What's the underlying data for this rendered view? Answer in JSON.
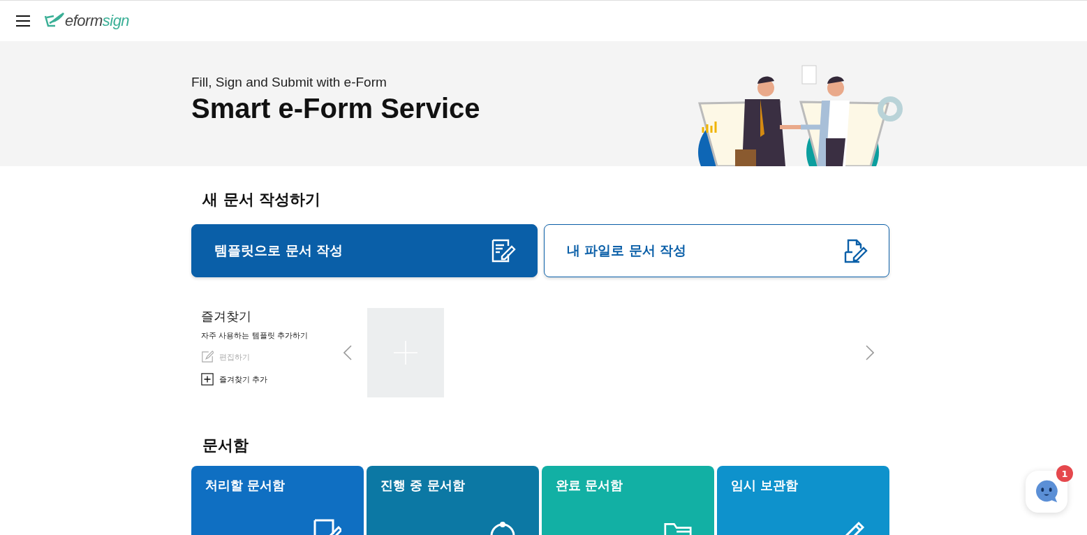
{
  "header": {
    "logo": {
      "text_main": "eform",
      "text_accent": "sign"
    }
  },
  "banner": {
    "subtitle": "Fill, Sign and Submit with e-Form",
    "title": "Smart e-Form Service"
  },
  "new_document": {
    "heading": "새 문서 작성하기",
    "actions": [
      {
        "label": "템플릿으로 문서 작성",
        "selected": true,
        "kind": "template"
      },
      {
        "label": "내 파일로 문서 작성",
        "selected": false,
        "kind": "file"
      }
    ]
  },
  "favorites": {
    "title": "즐겨찾기",
    "description": "자주 사용하는 템플릿 추가하기",
    "edit": {
      "label": "편집하기",
      "disabled": true
    },
    "add": {
      "label": "즐겨찾기 추가"
    }
  },
  "document_boxes": {
    "heading": "문서함",
    "boxes": [
      {
        "label": "처리할 문서함",
        "color": "#0f6fc2",
        "kind": "todo"
      },
      {
        "label": "진행 중 문서함",
        "color": "#0c78a4",
        "kind": "progress"
      },
      {
        "label": "완료 문서함",
        "color": "#12b0a4",
        "kind": "done"
      },
      {
        "label": "임시 보관함",
        "color": "#0e92cc",
        "kind": "draft"
      }
    ]
  },
  "chat": {
    "badge": "1"
  }
}
